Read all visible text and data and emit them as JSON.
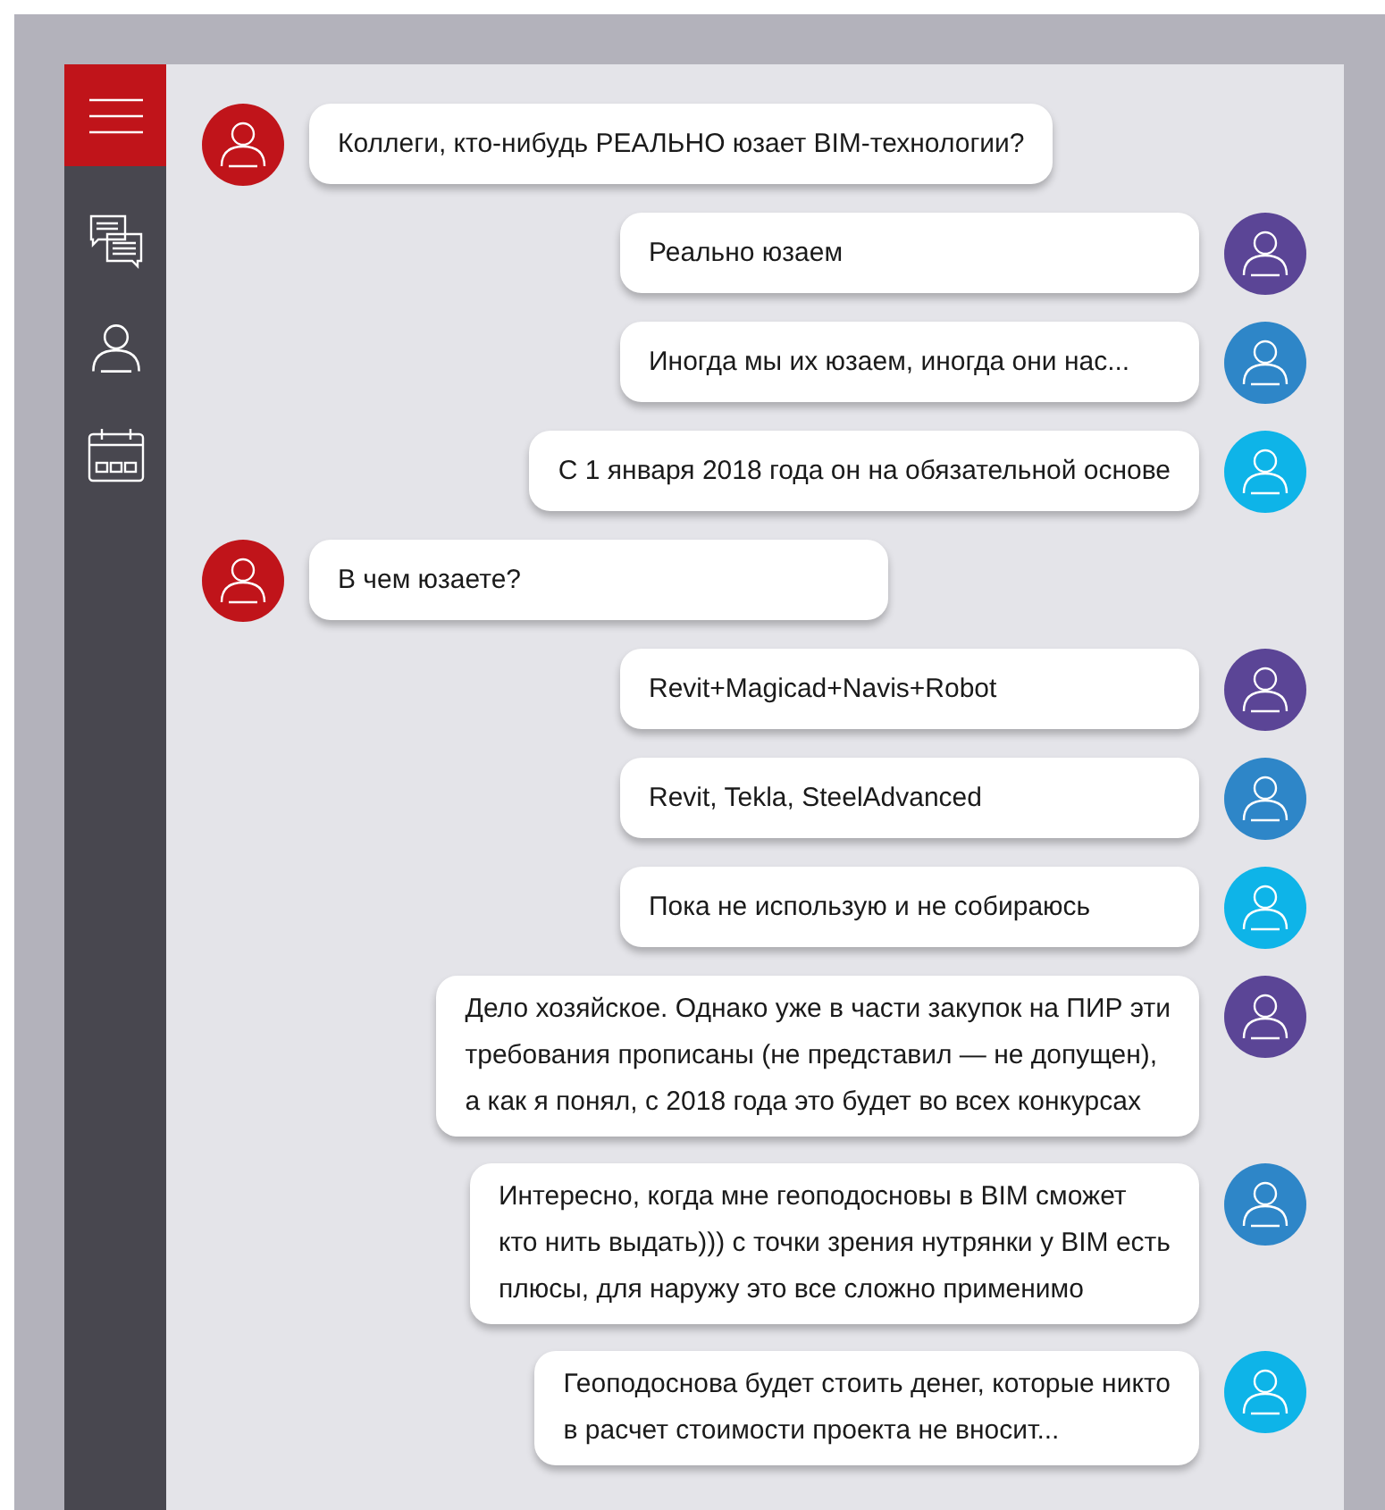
{
  "sidebar": {
    "items": [
      {
        "kind": "menu",
        "selected": true
      },
      {
        "kind": "chats",
        "selected": false
      },
      {
        "kind": "profile",
        "selected": false
      },
      {
        "kind": "calendar",
        "selected": false
      }
    ]
  },
  "messages": [
    {
      "outgoing": false,
      "color": "#c0141a",
      "lines": [
        "Коллеги, кто-нибудь РЕАЛЬНО юзает BIM-технологии?"
      ]
    },
    {
      "outgoing": true,
      "color": "#5b4596",
      "lines": [
        "Реально юзаем"
      ]
    },
    {
      "outgoing": true,
      "color": "#2e86c8",
      "lines": [
        "Иногда мы их юзаем, иногда они нас..."
      ]
    },
    {
      "outgoing": true,
      "color": "#0eb4e8",
      "lines": [
        "С 1 января 2018 года он на обязательной основе"
      ]
    },
    {
      "outgoing": false,
      "color": "#c0141a",
      "lines": [
        "В чем юзаете?"
      ]
    },
    {
      "outgoing": true,
      "color": "#5b4596",
      "lines": [
        "Revit+Magicad+Navis+Robot"
      ]
    },
    {
      "outgoing": true,
      "color": "#2e86c8",
      "lines": [
        "Revit, Tekla, SteelAdvanced"
      ]
    },
    {
      "outgoing": true,
      "color": "#0eb4e8",
      "lines": [
        "Пока не использую и не собираюсь"
      ]
    },
    {
      "outgoing": true,
      "color": "#5b4596",
      "lines": [
        "Дело хозяйское. Однако уже в части закупок на ПИР эти",
        "требования прописаны (не представил — не допущен),",
        "а как я понял, с 2018 года это будет во всех конкурсах"
      ]
    },
    {
      "outgoing": true,
      "color": "#2e86c8",
      "lines": [
        "Интересно, когда мне геоподосновы в BIM сможет",
        "кто нить выдать))) с точки зрения нутрянки у BIM есть",
        "плюсы, для наружу это все сложно применимо"
      ]
    },
    {
      "outgoing": true,
      "color": "#0eb4e8",
      "lines": [
        "Геоподоснова будет стоить денег, которые никто",
        "в расчет стоимости проекта не вносит..."
      ]
    }
  ]
}
